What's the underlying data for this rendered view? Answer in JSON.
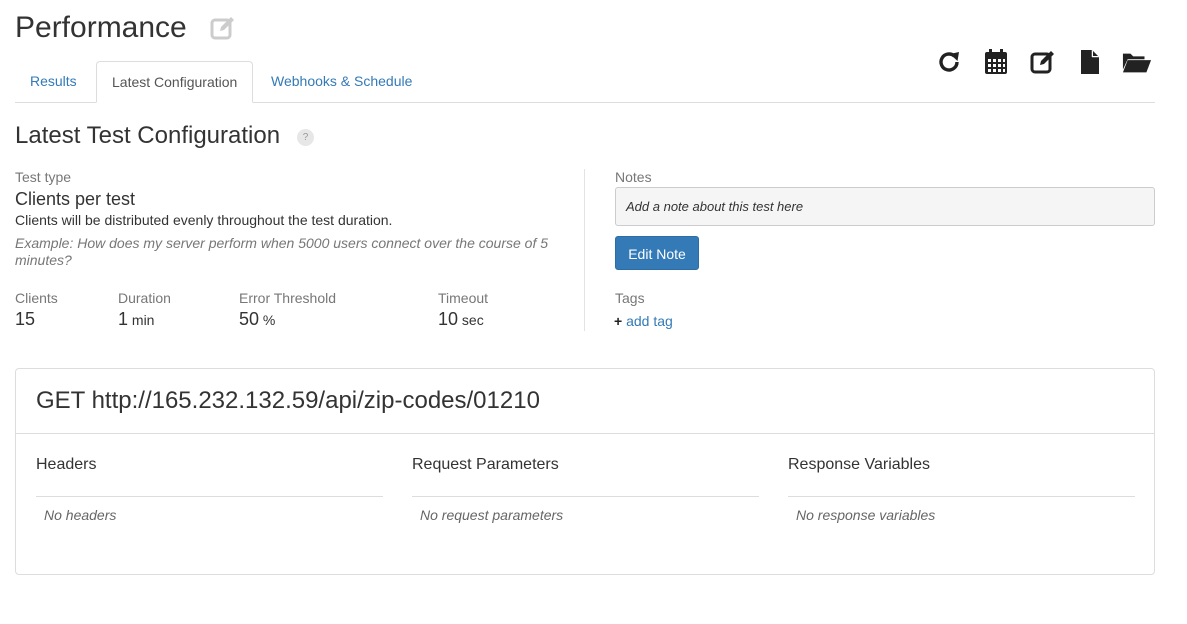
{
  "page": {
    "title": "Performance"
  },
  "toolbar": {
    "icons": [
      "refresh-icon",
      "calendar-icon",
      "edit-icon",
      "file-icon",
      "folder-open-icon"
    ]
  },
  "tabs": [
    {
      "label": "Results",
      "active": false
    },
    {
      "label": "Latest Configuration",
      "active": true
    },
    {
      "label": "Webhooks & Schedule",
      "active": false
    }
  ],
  "config": {
    "title": "Latest Test Configuration",
    "help": "?",
    "test_type_label": "Test type",
    "test_type": "Clients per test",
    "description": "Clients will be distributed evenly throughout the test duration.",
    "example": "Example: How does my server perform when 5000 users connect over the course of 5 minutes?",
    "stats": {
      "clients_label": "Clients",
      "clients_value": "15",
      "duration_label": "Duration",
      "duration_value": "1",
      "duration_unit": "min",
      "error_label": "Error Threshold",
      "error_value": "50",
      "error_unit": "%",
      "timeout_label": "Timeout",
      "timeout_value": "10",
      "timeout_unit": "sec"
    }
  },
  "notes": {
    "label": "Notes",
    "placeholder": "Add a note about this test here",
    "edit_button": "Edit Note"
  },
  "tags": {
    "label": "Tags",
    "add_icon": "+",
    "add_link": "add tag"
  },
  "request": {
    "title": "GET http://165.232.132.59/api/zip-codes/01210",
    "columns": [
      {
        "title": "Headers",
        "empty": "No headers"
      },
      {
        "title": "Request Parameters",
        "empty": "No request parameters"
      },
      {
        "title": "Response Variables",
        "empty": "No response variables"
      }
    ]
  },
  "colors": {
    "link": "#337ab7",
    "primary": "#337ab7",
    "border": "#dddddd"
  }
}
